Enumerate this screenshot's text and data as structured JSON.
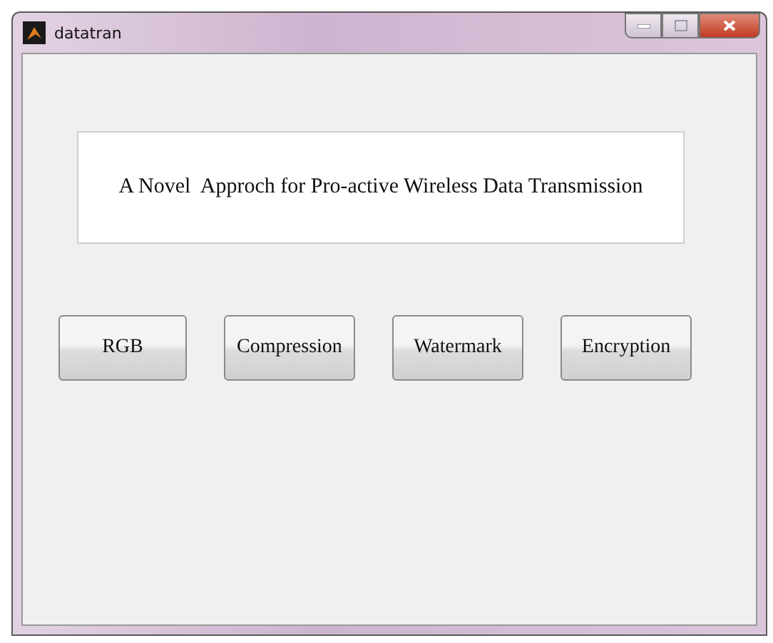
{
  "window": {
    "title": "datatran"
  },
  "heading": "A Novel  Approch for Pro-active Wireless Data Transmission",
  "buttons": [
    "RGB",
    "Compression",
    "Watermark",
    "Encryption"
  ]
}
